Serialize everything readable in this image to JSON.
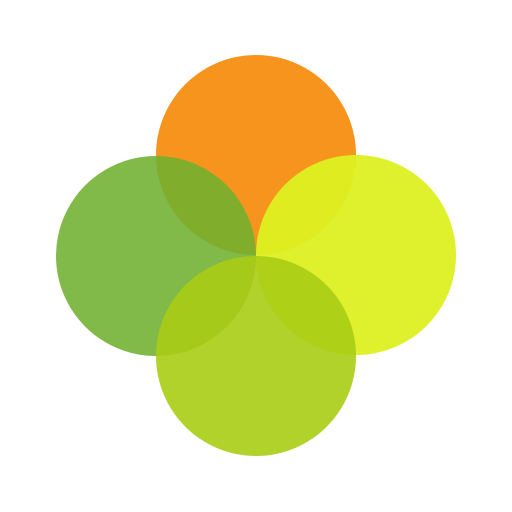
{
  "background": "#ffffff",
  "circles": [
    {
      "name": "top-circle",
      "color": "#f7941d",
      "opacity": 1.0
    },
    {
      "name": "right-circle",
      "color": "#dcf021",
      "opacity": 0.95
    },
    {
      "name": "left-circle",
      "color": "#6fb12f",
      "opacity": 0.88
    },
    {
      "name": "bottom-circle",
      "color": "#a8cc14",
      "opacity": 0.9
    }
  ]
}
